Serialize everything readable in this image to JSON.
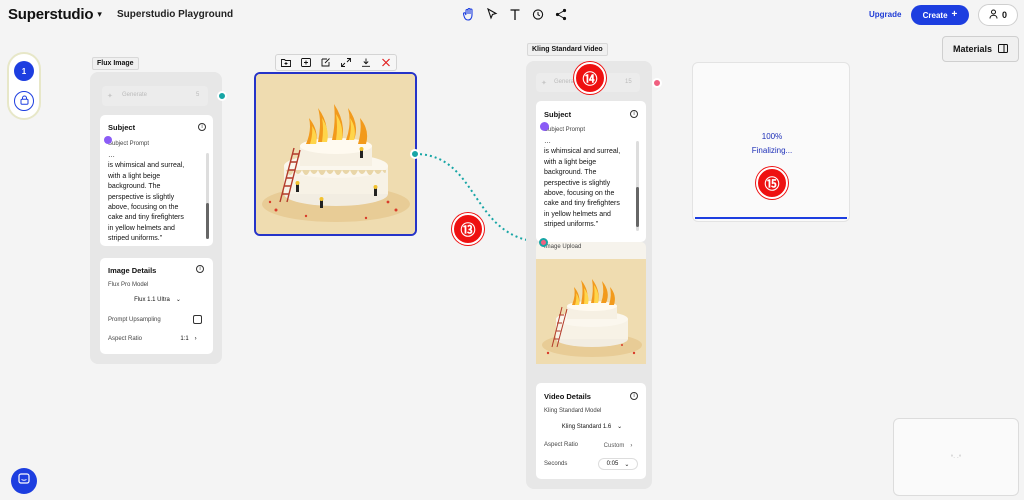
{
  "header": {
    "brand": "Superstudio",
    "project_title": "Superstudio Playground",
    "upgrade_label": "Upgrade",
    "create_label": "Create",
    "user_count": "0"
  },
  "sidebar": {
    "page_number": "1"
  },
  "materials_label": "Materials",
  "flux_node": {
    "label": "Flux Image",
    "generate_label": "Generate",
    "generate_cost": "5",
    "subject_title": "Subject",
    "subject_prompt_label": "Subject Prompt",
    "prompt_lines": [
      "…",
      "is whimsical and surreal,",
      "with a light beige",
      "background. The",
      "perspective is slightly",
      "above, focusing on the",
      "cake and tiny firefighters",
      "in yellow helmets and",
      "striped uniforms.”"
    ],
    "image_details_title": "Image Details",
    "model_label": "Flux Pro Model",
    "model_value": "Flux 1.1 Ultra",
    "upsampling_label": "Prompt Upsampling",
    "aspect_label": "Aspect Ratio",
    "aspect_value": "1:1"
  },
  "kling_node": {
    "label": "Kling Standard Video",
    "generate_label": "Generate",
    "generate_cost": "15",
    "subject_title": "Subject",
    "subject_prompt_label": "Subject Prompt",
    "prompt_lines": [
      "…",
      "is whimsical and surreal,",
      "with a light beige",
      "background. The",
      "perspective is slightly",
      "above, focusing on the",
      "cake and tiny firefighters",
      "in yellow helmets and",
      "striped uniforms.”"
    ],
    "image_upload_label": "Image Upload",
    "video_details_title": "Video Details",
    "model_label": "Kling Standard Model",
    "model_value": "Kling Standard 1.6",
    "aspect_label": "Aspect Ratio",
    "aspect_value": "Custom",
    "seconds_label": "Seconds",
    "seconds_value": "0:05"
  },
  "progress": {
    "percent": "100%",
    "status": "Finalizing..."
  },
  "annotations": [
    "⑬",
    "⑭",
    "⑮"
  ],
  "preview_text": "°· ·°",
  "colors": {
    "accent": "#1d3ee0",
    "connector": "#17a5a5",
    "port_purple": "#8b5cf6",
    "port_pink": "#f06080",
    "annotation_red": "#e11111"
  },
  "icons": [
    "hand-icon",
    "cursor-icon",
    "text-icon",
    "clock-icon",
    "share-icon",
    "plus-icon",
    "user-icon",
    "lock-icon",
    "panel-icon",
    "info-icon",
    "chevron-down-icon",
    "chevron-right-icon",
    "add-folder-icon",
    "add-frame-icon",
    "edit-icon",
    "expand-icon",
    "download-icon",
    "close-icon",
    "chat-icon"
  ]
}
